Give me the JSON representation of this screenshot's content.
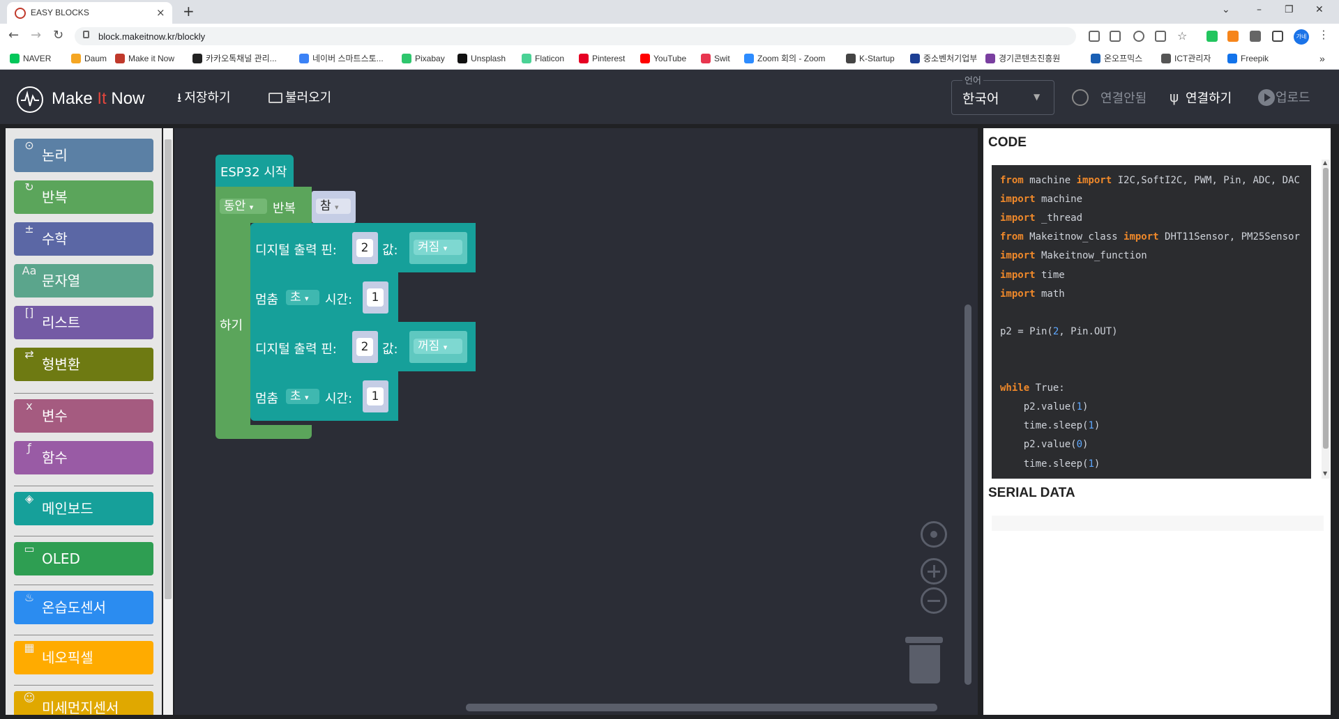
{
  "browser": {
    "tab_title": "EASY BLOCKS",
    "tab_close": "×",
    "new_tab": "+",
    "window_controls": [
      "⌄",
      "–",
      "❐",
      "✕"
    ],
    "url": "block.makeitnow.kr/blockly",
    "nav": {
      "back": "←",
      "forward": "→",
      "reload": "↻"
    },
    "bookmarks": [
      {
        "label": "NAVER",
        "icon": "naver-icon",
        "color": "#03c75a"
      },
      {
        "label": "Daum",
        "icon": "daum-icon",
        "color": "#f5a623"
      },
      {
        "label": "Make it Now",
        "icon": "makeitnow-icon",
        "color": "#c0392b"
      },
      {
        "label": "카카오톡채널 관리...",
        "icon": "kakao-icon",
        "color": "#222222"
      },
      {
        "label": "네이버 스마트스토...",
        "icon": "smartstore-icon",
        "color": "#3b82f6"
      },
      {
        "label": "Pixabay",
        "icon": "pixabay-icon",
        "color": "#2ec66d"
      },
      {
        "label": "Unsplash",
        "icon": "unsplash-icon",
        "color": "#111111"
      },
      {
        "label": "Flaticon",
        "icon": "flaticon-icon",
        "color": "#4ad295"
      },
      {
        "label": "Pinterest",
        "icon": "pinterest-icon",
        "color": "#e60023"
      },
      {
        "label": "YouTube",
        "icon": "youtube-icon",
        "color": "#ff0000"
      },
      {
        "label": "Swit",
        "icon": "swit-icon",
        "color": "#e8364f"
      },
      {
        "label": "Zoom 회의 - Zoom",
        "icon": "zoom-icon",
        "color": "#2d8cff"
      },
      {
        "label": "K-Startup",
        "icon": "kstartup-icon",
        "color": "#444444"
      },
      {
        "label": "중소벤처기업부",
        "icon": "mss-icon",
        "color": "#1c3f94"
      },
      {
        "label": "경기콘텐츠진흥원",
        "icon": "gcon-icon",
        "color": "#7a3fa0"
      },
      {
        "label": "온오프믹스",
        "icon": "onoffmix-icon",
        "color": "#1a5fb4"
      },
      {
        "label": "ICT관리자",
        "icon": "ict-icon",
        "color": "#555555"
      },
      {
        "label": "Freepik",
        "icon": "freepik-icon",
        "color": "#1273eb"
      }
    ],
    "bookmarks_more": "»",
    "profile_label": "가네"
  },
  "header": {
    "logo_text_a": "Make",
    "logo_text_b": "It",
    "logo_text_c": "Now",
    "save_label": "저장하기",
    "load_label": "불러오기",
    "language_legend": "언어",
    "language_value": "한국어",
    "status_label": "연결안됨",
    "connect_label": "연결하기",
    "upload_label": "업로드"
  },
  "toolbox": {
    "categories": [
      {
        "label": "논리",
        "color": "#5b80a5",
        "icon": "logic-icon"
      },
      {
        "label": "반복",
        "color": "#5ba55b",
        "icon": "loop-icon"
      },
      {
        "label": "수학",
        "color": "#5b67a5",
        "icon": "math-icon"
      },
      {
        "label": "문자열",
        "color": "#5ba58c",
        "icon": "text-icon"
      },
      {
        "label": "리스트",
        "color": "#745ba5",
        "icon": "list-icon"
      },
      {
        "label": "형변환",
        "color": "#6e7a12",
        "icon": "convert-icon"
      },
      {
        "label": "변수",
        "color": "#a55b80",
        "icon": "variable-icon"
      },
      {
        "label": "함수",
        "color": "#995ba5",
        "icon": "function-icon"
      },
      {
        "label": "메인보드",
        "color": "#16a09a",
        "icon": "mainboard-icon"
      },
      {
        "label": "OLED",
        "color": "#2e9e52",
        "icon": "oled-icon"
      },
      {
        "label": "온습도센서",
        "color": "#2b8cf0",
        "icon": "humidity-icon"
      },
      {
        "label": "네오픽셀",
        "color": "#ffab00",
        "icon": "neopixel-icon"
      },
      {
        "label": "미세먼지센서",
        "color": "#e0a800",
        "icon": "dust-sensor-icon"
      }
    ]
  },
  "blocks": {
    "start_label": "ESP32 시작",
    "loop_mode": "동안",
    "loop_label": "반복",
    "loop_cond": "참",
    "do_label": "하기",
    "digital1_label": "디지털 출력 핀:",
    "digital1_pin": "2",
    "value_label": "값:",
    "digital1_val": "켜짐",
    "sleep1_label": "멈춤",
    "sleep_unit": "초",
    "time_label": "시간:",
    "sleep1_val": "1",
    "digital2_label": "디지털 출력 핀:",
    "digital2_pin": "2",
    "digital2_val": "꺼짐",
    "sleep2_label": "멈춤",
    "sleep2_val": "1",
    "dropdown_arrow": "▾"
  },
  "code_panel": {
    "title": "CODE",
    "lines": [
      [
        {
          "t": "from",
          "c": "kw"
        },
        {
          "t": " machine ",
          "c": "nm"
        },
        {
          "t": "import",
          "c": "kw"
        },
        {
          "t": " I2C,SoftI2C, PWM, Pin, ADC, DAC",
          "c": "nm"
        }
      ],
      [
        {
          "t": "import",
          "c": "kw"
        },
        {
          "t": " machine",
          "c": "nm"
        }
      ],
      [
        {
          "t": "import",
          "c": "kw"
        },
        {
          "t": " _thread",
          "c": "nm"
        }
      ],
      [
        {
          "t": "from",
          "c": "kw"
        },
        {
          "t": " Makeitnow_class ",
          "c": "nm"
        },
        {
          "t": "import",
          "c": "kw"
        },
        {
          "t": " DHT11Sensor, PM25Sensor",
          "c": "nm"
        }
      ],
      [
        {
          "t": "import",
          "c": "kw"
        },
        {
          "t": " Makeitnow_function",
          "c": "nm"
        }
      ],
      [
        {
          "t": "import",
          "c": "kw"
        },
        {
          "t": " time",
          "c": "nm"
        }
      ],
      [
        {
          "t": "import",
          "c": "kw"
        },
        {
          "t": " math",
          "c": "nm"
        }
      ],
      [],
      [
        {
          "t": "p2 = Pin(",
          "c": "nm"
        },
        {
          "t": "2",
          "c": "num"
        },
        {
          "t": ", Pin.OUT)",
          "c": "nm"
        }
      ],
      [],
      [],
      [
        {
          "t": "while",
          "c": "kw"
        },
        {
          "t": " True:",
          "c": "nm"
        }
      ],
      [
        {
          "t": "    p2.value(",
          "c": "nm"
        },
        {
          "t": "1",
          "c": "num"
        },
        {
          "t": ")",
          "c": "nm"
        }
      ],
      [
        {
          "t": "    time.sleep(",
          "c": "nm"
        },
        {
          "t": "1",
          "c": "num"
        },
        {
          "t": ")",
          "c": "nm"
        }
      ],
      [
        {
          "t": "    p2.value(",
          "c": "nm"
        },
        {
          "t": "0",
          "c": "num"
        },
        {
          "t": ")",
          "c": "nm"
        }
      ],
      [
        {
          "t": "    time.sleep(",
          "c": "nm"
        },
        {
          "t": "1",
          "c": "num"
        },
        {
          "t": ")",
          "c": "nm"
        }
      ]
    ]
  },
  "serial_panel": {
    "title": "SERIAL DATA"
  }
}
